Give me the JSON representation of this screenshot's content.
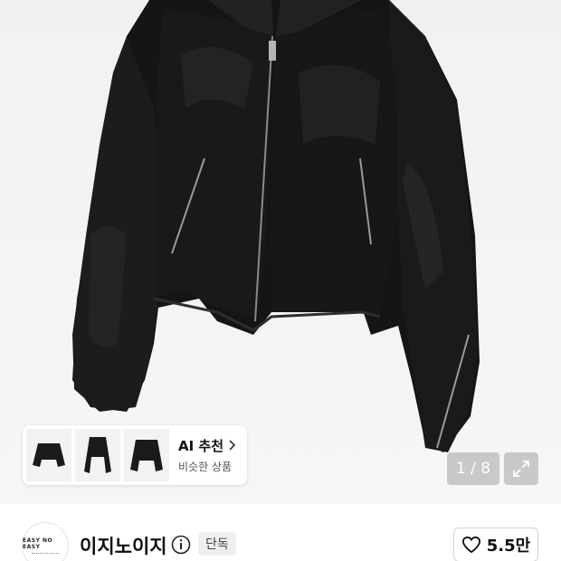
{
  "product_image": {
    "counter_current": "1",
    "counter_total": "8",
    "counter_text": "1 / 8",
    "expand_icon": "expand-arrows-icon"
  },
  "ai_recommend": {
    "title": "AI 추천",
    "subtitle": "비슷한 상품",
    "thumbnails": [
      {
        "name": "similar-jacket-1"
      },
      {
        "name": "similar-jacket-2"
      },
      {
        "name": "similar-jacket-3"
      }
    ]
  },
  "brand": {
    "name": "이지노이지",
    "logo_text": "EASY NO EASY",
    "badge": "단독",
    "info_icon": "info-circle-icon"
  },
  "like": {
    "icon": "heart-outline-icon",
    "count": "5.5만"
  },
  "colors": {
    "overlay": "rgba(0,0,0,0.18)",
    "badge_bg": "#efefef",
    "jacket": "#151515"
  }
}
